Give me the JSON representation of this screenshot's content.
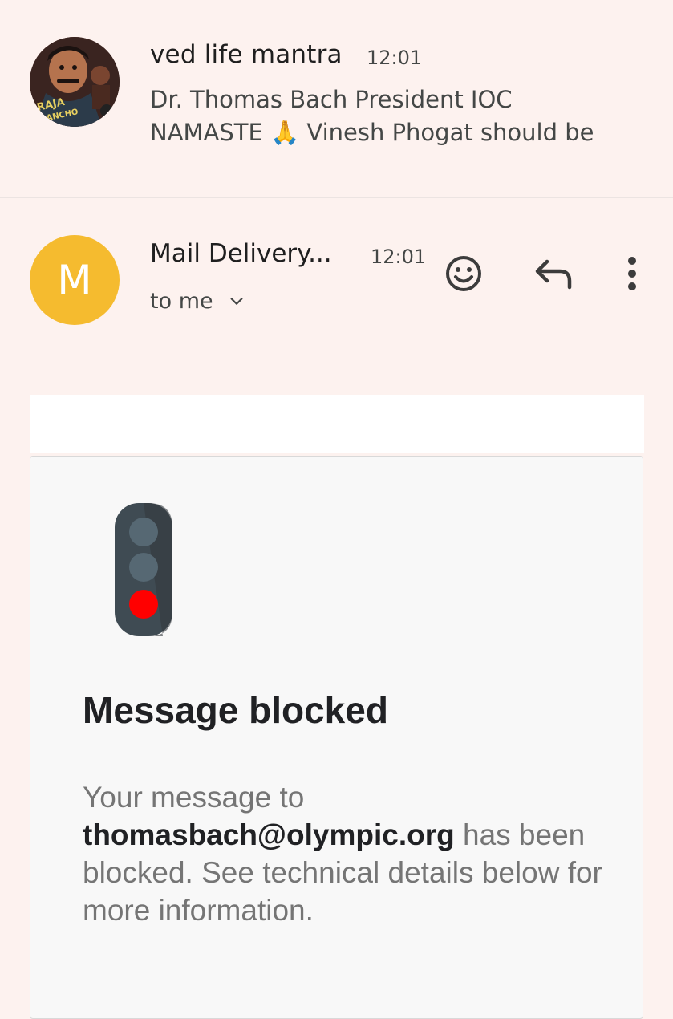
{
  "thread_item": {
    "sender": "ved life mantra",
    "time": "12:01",
    "snippet_line1": "Dr. Thomas Bach President IOC",
    "snippet_line2": "NAMASTE 🙏 Vinesh Phogat should be",
    "avatar_icon": "movie-poster-avatar"
  },
  "message_header": {
    "avatar_letter": "M",
    "avatar_color": "#f5bb2f",
    "sender": "Mail Delivery...",
    "time": "12:01",
    "recipient": "to me",
    "actions": [
      "smiley-face-icon",
      "reply-icon",
      "more-vert-icon"
    ]
  },
  "message_body": {
    "title": "Message blocked",
    "text_before": "Your message to ",
    "email": "thomasbach@olympic.org",
    "text_after": " has been blocked. See technical details below for more information.",
    "icon": "traffic-light-icon"
  }
}
